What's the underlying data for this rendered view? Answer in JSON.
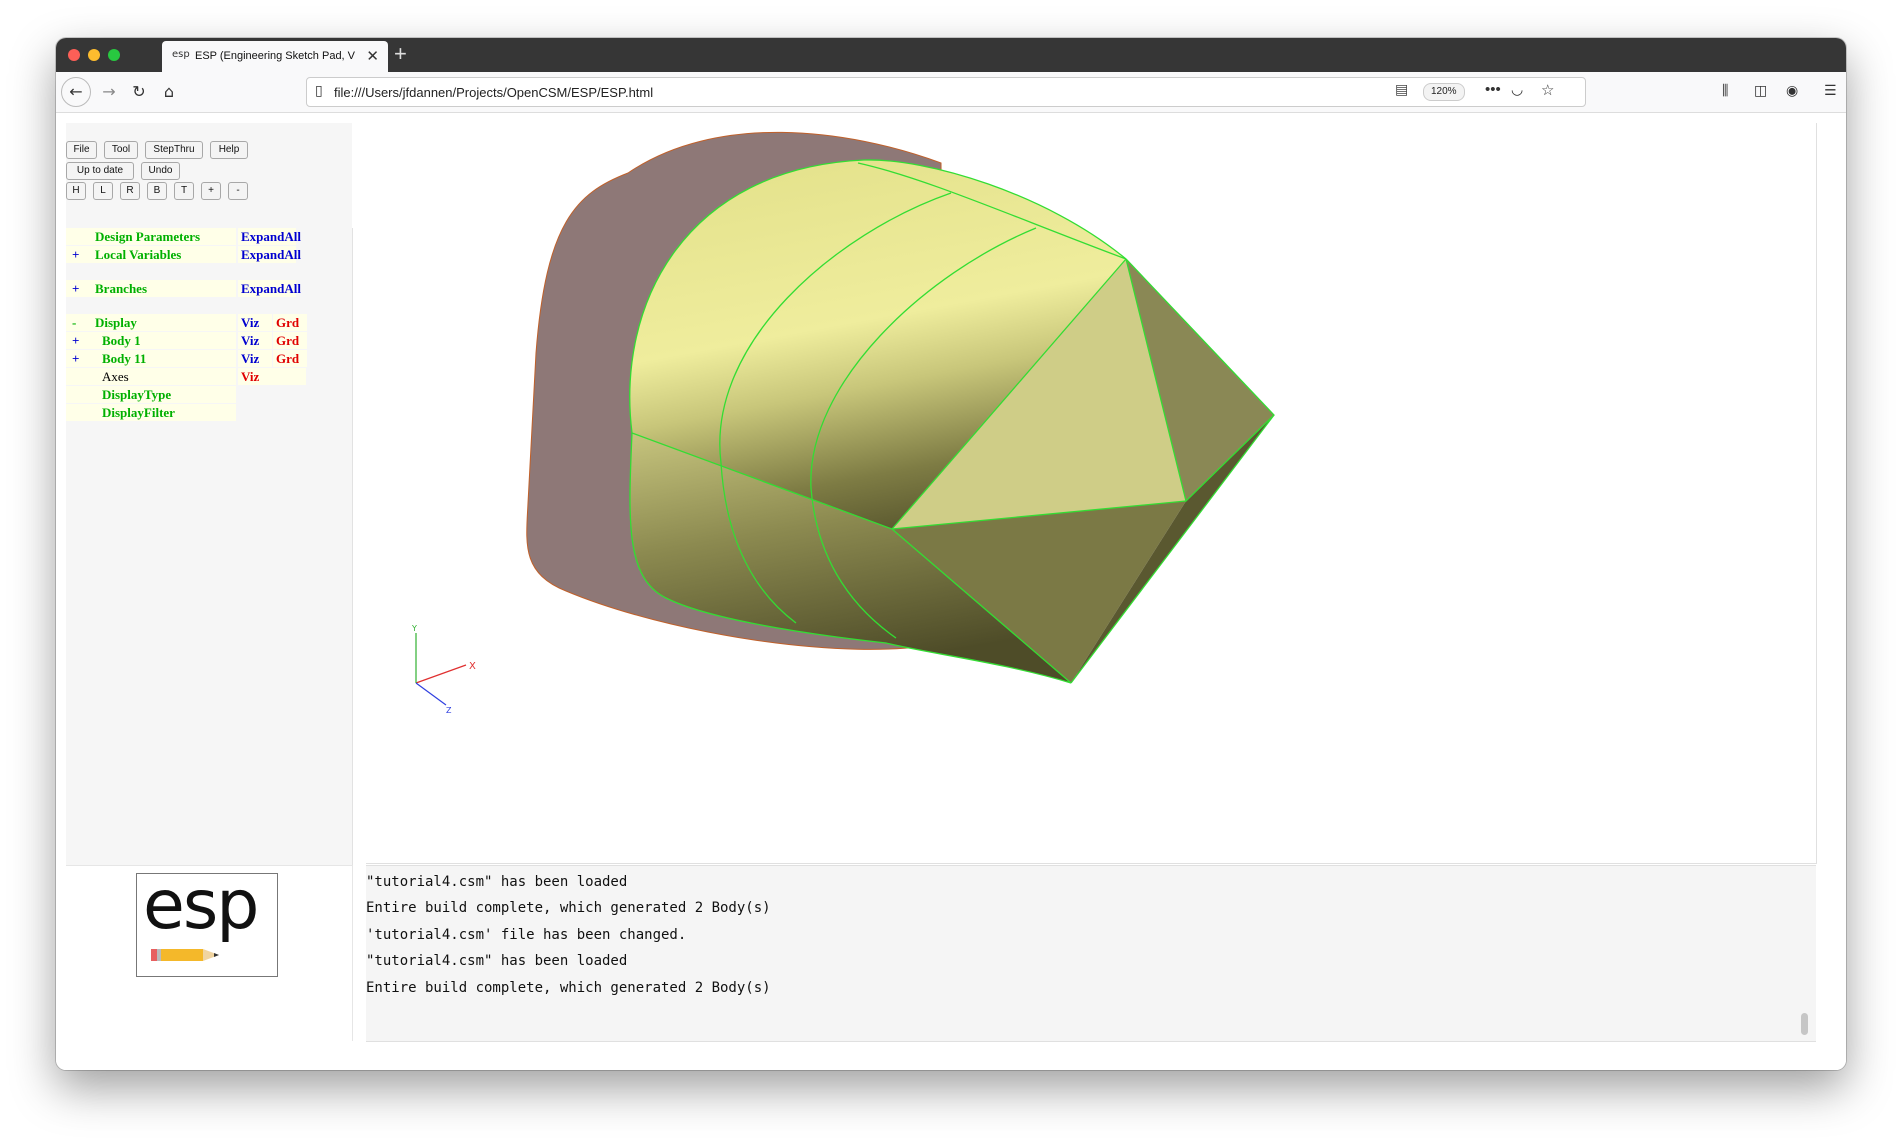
{
  "browser": {
    "tab_title": "ESP (Engineering Sketch Pad, V",
    "tab_favicon": "esp",
    "url": "file:///Users/jfdannen/Projects/OpenCSM/ESP/ESP.html",
    "zoom": "120%",
    "more_label": "•••"
  },
  "menu": {
    "file": "File",
    "tool": "Tool",
    "stepthru": "StepThru",
    "help": "Help",
    "uptodate": "Up to date",
    "undo": "Undo",
    "views": [
      "H",
      "L",
      "R",
      "B",
      "T",
      "+",
      "-"
    ]
  },
  "tree": {
    "design_parameters": {
      "label": "Design Parameters",
      "action": "ExpandAll"
    },
    "local_variables": {
      "prefix": "+",
      "label": "Local Variables",
      "action": "ExpandAll"
    },
    "branches": {
      "prefix": "+",
      "label": "Branches",
      "action": "ExpandAll"
    },
    "display": {
      "prefix": "-",
      "label": "Display",
      "viz": "Viz",
      "grd": "Grd"
    },
    "body1": {
      "prefix": "+",
      "label": "Body 1",
      "viz": "Viz",
      "grd": "Grd"
    },
    "body11": {
      "prefix": "+",
      "label": "Body 11",
      "viz": "Viz",
      "grd": "Grd"
    },
    "axes": {
      "label": "Axes",
      "viz": "Viz"
    },
    "display_type": {
      "label": "DisplayType"
    },
    "display_filter": {
      "label": "DisplayFilter"
    }
  },
  "axes_labels": {
    "x": "X",
    "y": "Y",
    "z": "Z"
  },
  "logo": {
    "text": "esp"
  },
  "messages": [
    "\"tutorial4.csm\" has been loaded",
    "Entire build complete, which generated 2 Body(s)",
    "'tutorial4.csm' file has been changed.",
    "\"tutorial4.csm\" has been loaded",
    "Entire build complete, which generated 2 Body(s)"
  ],
  "colors": {
    "accent_green": "#00b000",
    "link_blue": "#0000d0",
    "grd_red": "#e00000",
    "body_yellow": "#ecea98",
    "sheet_mauve": "#8e7877",
    "edge_green": "#33dd33"
  }
}
